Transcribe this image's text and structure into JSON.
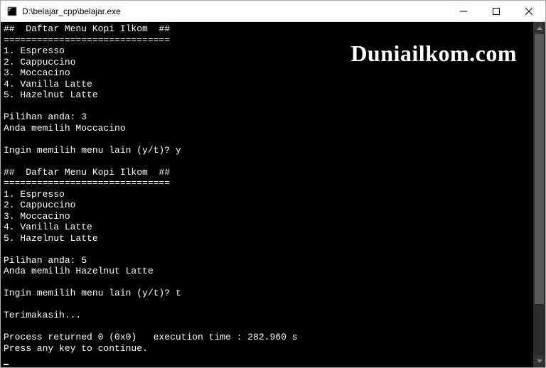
{
  "window": {
    "title": "D:\\belajar_cpp\\belajar.exe"
  },
  "watermark": "Duniailkom.com",
  "console": {
    "header": "##  Daftar Menu Kopi Ilkom  ##",
    "separator": "==============================",
    "menu": [
      "1. Espresso",
      "2. Cappuccino",
      "3. Moccacino",
      "4. Vanilla Latte",
      "5. Hazelnut Latte"
    ],
    "prompt_choice": "Pilihan anda: ",
    "prompt_again": "Ingin memilih menu lain (y/t)? ",
    "result_prefix": "Anda memilih ",
    "runs": [
      {
        "choice": "3",
        "result": "Moccacino",
        "again": "y"
      },
      {
        "choice": "5",
        "result": "Hazelnut Latte",
        "again": "t"
      }
    ],
    "thanks": "Terimakasih...",
    "process_line": "Process returned 0 (0x0)   execution time : 282.960 s",
    "press_key": "Press any key to continue."
  }
}
